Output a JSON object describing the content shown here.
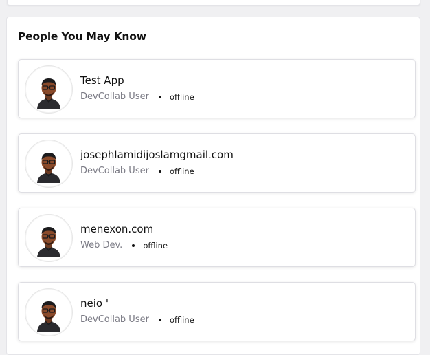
{
  "section": {
    "title": "People You May Know"
  },
  "people": [
    {
      "name": "Test App",
      "role": "DevCollab User",
      "status": "offline",
      "avatar_icon": "developer-avatar-icon"
    },
    {
      "name": "josephlamidijoslamgmail.com",
      "role": "DevCollab User",
      "status": "offline",
      "avatar_icon": "developer-avatar-icon"
    },
    {
      "name": "menexon.com",
      "role": "Web Dev.",
      "status": "offline",
      "avatar_icon": "developer-avatar-icon"
    },
    {
      "name": "neio '",
      "role": "DevCollab User",
      "status": "offline",
      "avatar_icon": "developer-avatar-icon"
    }
  ],
  "colors": {
    "background": "#f0f0f2",
    "card": "#ffffff",
    "muted_text": "#7a7a84",
    "text": "#111111"
  }
}
